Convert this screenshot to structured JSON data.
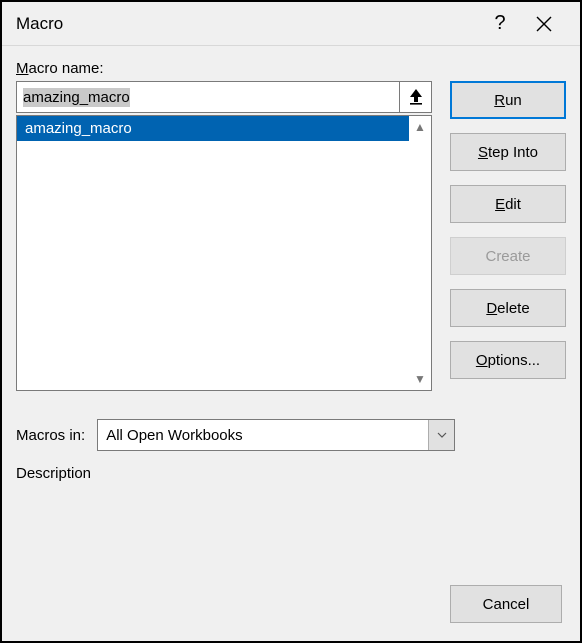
{
  "titlebar": {
    "title": "Macro"
  },
  "labels": {
    "macro_name_pre": "M",
    "macro_name_rest": "acro name:",
    "macros_in_pre": "M",
    "macros_in_rest": "acros in:",
    "description": "Description"
  },
  "name_input": {
    "value": "amazing_macro"
  },
  "list": {
    "items": [
      {
        "label": "amazing_macro",
        "selected": true
      }
    ]
  },
  "combo": {
    "value": "All Open Workbooks"
  },
  "buttons": {
    "run_pre": "R",
    "run_rest": "un",
    "step_pre": "S",
    "step_rest": "tep Into",
    "edit_pre": "E",
    "edit_rest": "dit",
    "create": "Create",
    "delete_pre": "D",
    "delete_rest": "elete",
    "options_pre": "O",
    "options_rest": "ptions...",
    "cancel": "Cancel"
  }
}
